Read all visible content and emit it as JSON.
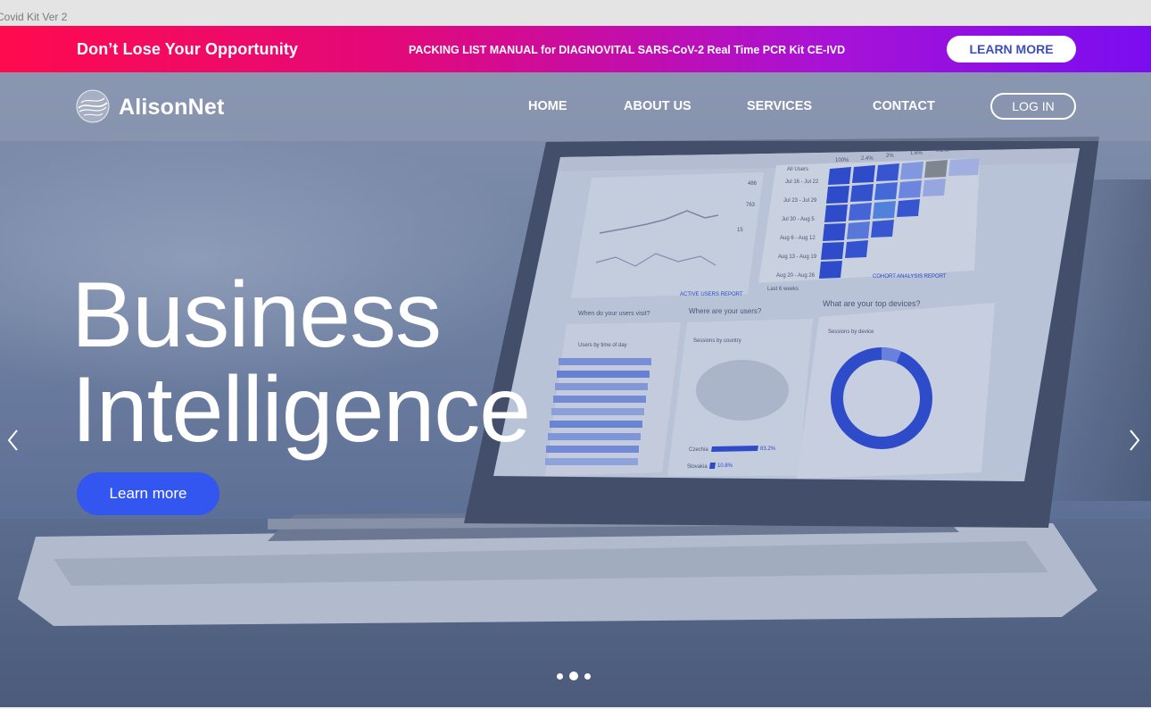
{
  "frame": {
    "title": "Covid Kit Ver 2"
  },
  "promo": {
    "title": "Don’t Lose  Your Opportunity",
    "text": "PACKING LIST MANUAL for DIAGNOVITAL SARS-CoV-2 Real Time PCR Kit CE-IVD",
    "button_label": "LEARN MORE",
    "gradient_colors": [
      "#ff0a4e",
      "#e2097b",
      "#a812d6",
      "#7a0df0"
    ]
  },
  "nav": {
    "brand": "AlisonNet",
    "logo_icon": "globe-swirl-icon",
    "items": [
      {
        "label": "HOME"
      },
      {
        "label": "ABOUT US"
      },
      {
        "label": "SERVICES"
      },
      {
        "label": "CONTACT"
      }
    ],
    "login_label": "LOG IN"
  },
  "hero": {
    "headline_line1": "Business",
    "headline_line2": "Intelligence",
    "cta_label": "Learn more",
    "cta_color": "#3355f0",
    "prev_icon": "chevron-left-icon",
    "next_icon": "chevron-right-icon",
    "slides_count": 3,
    "active_slide": 2,
    "screen": {
      "legend": "All Users",
      "percent_headers": [
        "100%",
        "2.4%",
        "2%",
        "1.6%",
        "0.2%"
      ],
      "cohort_rows": [
        "Jul 16 - Jul 22",
        "Jul 23 - Jul 29",
        "Jul 30 - Aug 5",
        "Aug 6 - Aug 12",
        "Aug 13 - Aug 19",
        "Aug 20 - Aug 26"
      ],
      "cohort_report_label": "COHORT ANALYSIS REPORT",
      "range_label": "Last 6 weeks",
      "active_users_label": "ACTIVE USERS REPORT",
      "metrics": [
        "486",
        "763",
        "15"
      ],
      "question_1": "When do your users visit?",
      "question_2": "Where are your users?",
      "question_3": "What are your top devices?",
      "panel_time": "Users by time of day",
      "panel_country": "Sessions by country",
      "panel_device": "Sessions by device",
      "country_rows": [
        {
          "name": "Czechia",
          "value": "83.2%"
        },
        {
          "name": "Slovakia",
          "value": "10.8%"
        }
      ],
      "accent_color": "#1f3ed6"
    }
  }
}
